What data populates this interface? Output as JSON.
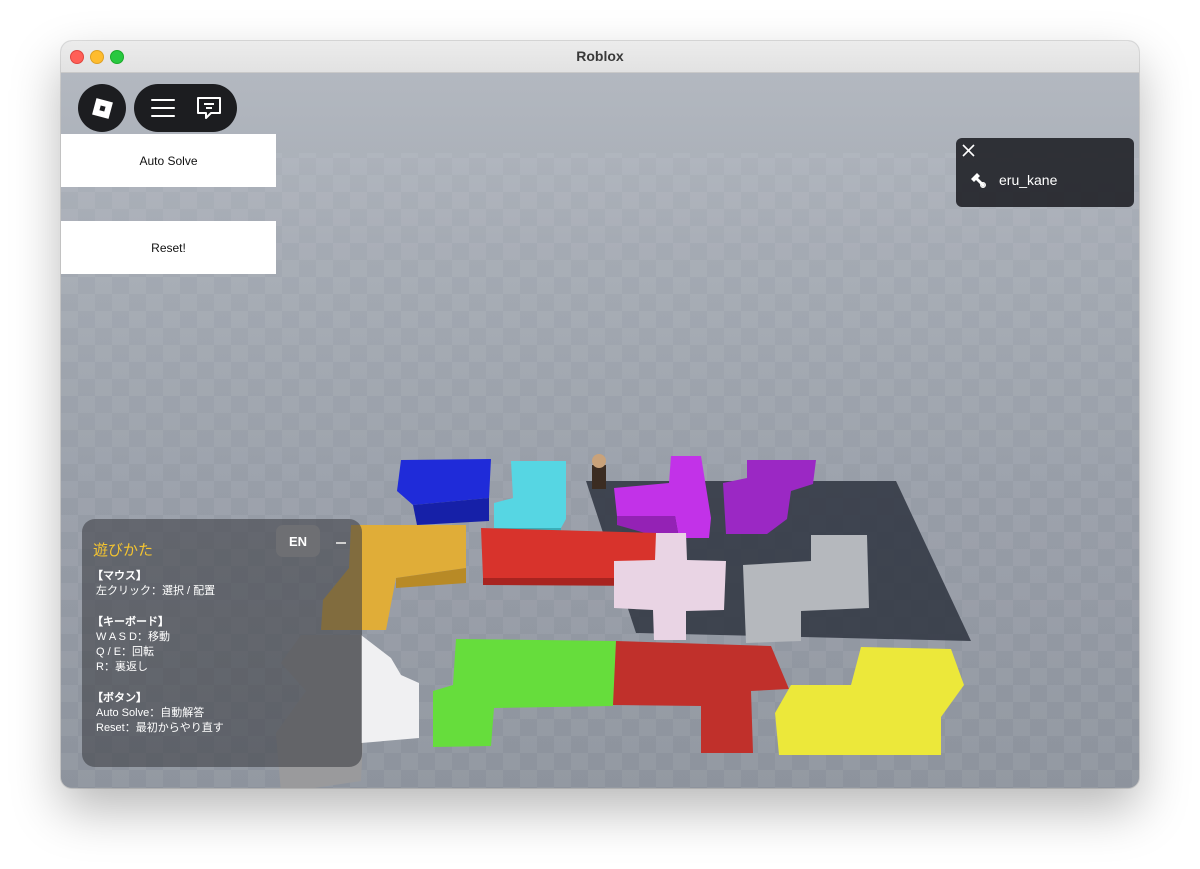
{
  "window": {
    "title": "Roblox"
  },
  "topbar": {
    "logo_icon": "roblox-logo-icon",
    "menu_icon": "hamburger-menu-icon",
    "chat_icon": "chat-icon"
  },
  "buttons": {
    "auto_solve": "Auto Solve",
    "reset": "Reset!"
  },
  "player_list": {
    "close_icon": "close-icon",
    "players": [
      {
        "name": "eru_kane",
        "badge_icon": "developer-hammer-icon"
      }
    ]
  },
  "help": {
    "title": "遊びかた",
    "lang_button": "EN",
    "sections": [
      {
        "heading": "【マウス】",
        "lines": [
          "左クリック：選択 / 配置"
        ]
      },
      {
        "heading": "【キーボード】",
        "lines": [
          "W A S D：移動",
          "Q / E：回転",
          "R：裏返し"
        ]
      },
      {
        "heading": "【ボタン】",
        "lines": [
          "Auto Solve：自動解答",
          "Reset：最初からやり直す"
        ]
      }
    ]
  },
  "colors": {
    "title_color": "#f4c430",
    "pieces": [
      "#1f2bd9",
      "#56d6e3",
      "#c232e8",
      "#9b28c4",
      "#e0ad38",
      "#d8332c",
      "#e9d4e4",
      "#b5b8bd",
      "#9a9a9c",
      "#66dd3c",
      "#c0302b",
      "#ece83a"
    ]
  }
}
